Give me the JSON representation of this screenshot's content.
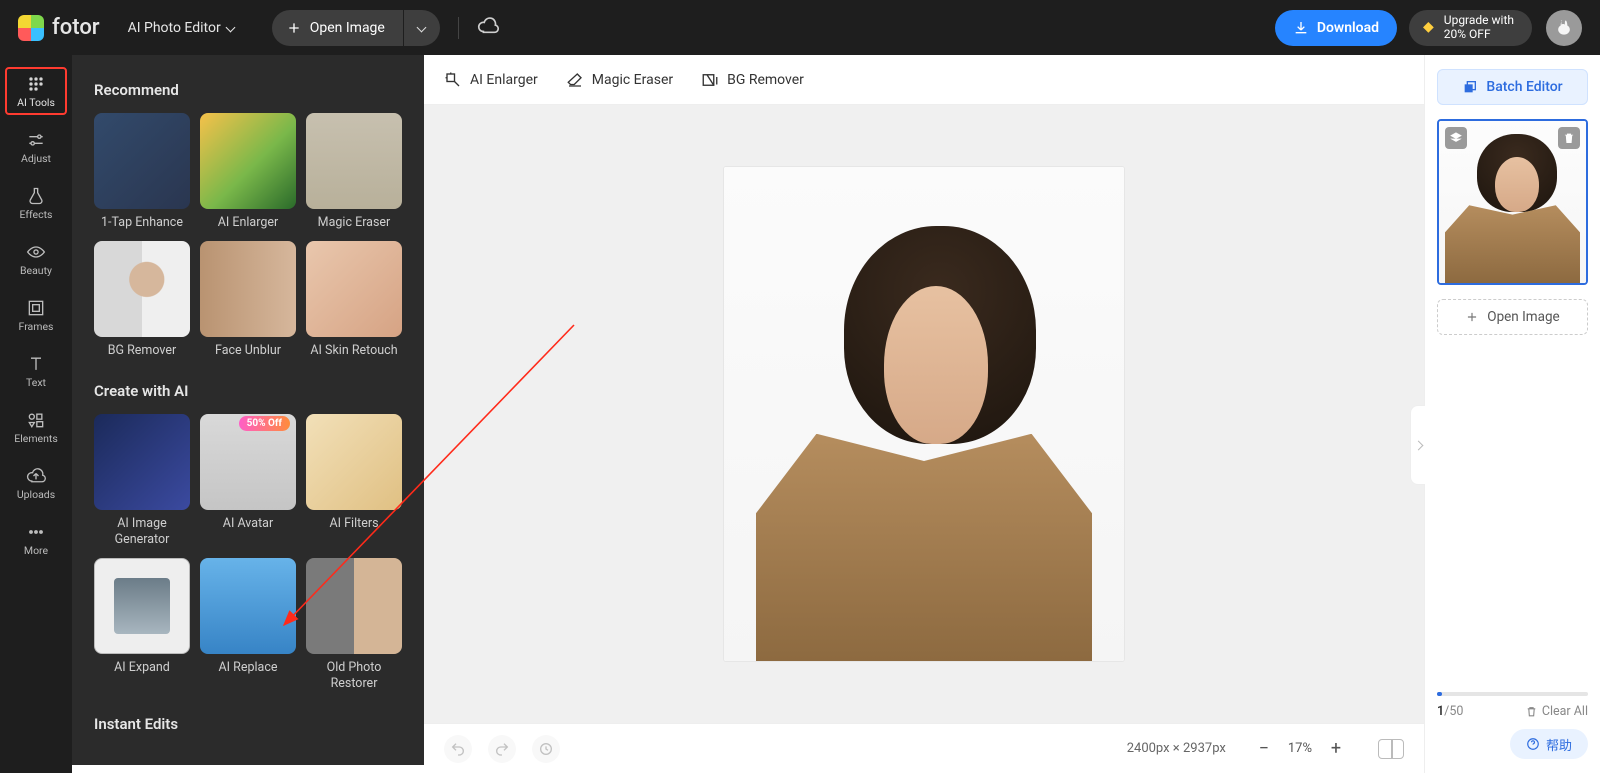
{
  "header": {
    "brand": "fotor",
    "mode": "AI Photo Editor",
    "open_image": "Open Image",
    "download": "Download",
    "upgrade_line1": "Upgrade with",
    "upgrade_line2": "20% OFF"
  },
  "rail": {
    "items": [
      {
        "id": "ai-tools",
        "label": "AI Tools"
      },
      {
        "id": "adjust",
        "label": "Adjust"
      },
      {
        "id": "effects",
        "label": "Effects"
      },
      {
        "id": "beauty",
        "label": "Beauty"
      },
      {
        "id": "frames",
        "label": "Frames"
      },
      {
        "id": "text",
        "label": "Text"
      },
      {
        "id": "elements",
        "label": "Elements"
      },
      {
        "id": "uploads",
        "label": "Uploads"
      },
      {
        "id": "more",
        "label": "More"
      }
    ]
  },
  "panel": {
    "section_recommend": "Recommend",
    "recommend": [
      {
        "id": "1tap",
        "label": "1-Tap Enhance"
      },
      {
        "id": "enlarge",
        "label": "AI Enlarger"
      },
      {
        "id": "eraser",
        "label": "Magic Eraser"
      },
      {
        "id": "bgrem",
        "label": "BG Remover"
      },
      {
        "id": "unblur",
        "label": "Face Unblur"
      },
      {
        "id": "skin",
        "label": "AI Skin Retouch"
      }
    ],
    "section_create": "Create with AI",
    "create": [
      {
        "id": "imggen",
        "label": "AI Image Generator"
      },
      {
        "id": "avatar",
        "label": "AI Avatar",
        "sale": "50% Off"
      },
      {
        "id": "filters",
        "label": "AI Filters"
      },
      {
        "id": "expand",
        "label": "AI Expand"
      },
      {
        "id": "replace",
        "label": "AI Replace"
      },
      {
        "id": "oldphoto",
        "label": "Old Photo Restorer"
      }
    ],
    "section_instant": "Instant Edits"
  },
  "top_actions": {
    "enlarger": "AI Enlarger",
    "eraser": "Magic Eraser",
    "bgrem": "BG Remover"
  },
  "bottom": {
    "dims": "2400px × 2937px",
    "zoom": "17%"
  },
  "right": {
    "batch": "Batch Editor",
    "open_image": "Open Image",
    "count_current": "1",
    "count_total": "/50",
    "clear_all": "Clear All",
    "help": "帮助"
  }
}
